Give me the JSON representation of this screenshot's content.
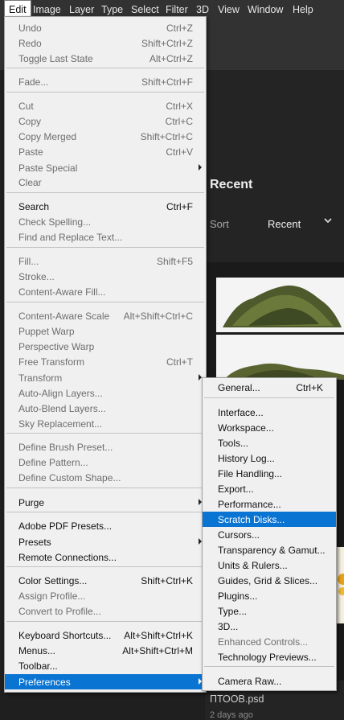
{
  "menubar": {
    "items": [
      "Edit",
      "Image",
      "Layer",
      "Type",
      "Select",
      "Filter",
      "3D",
      "View",
      "Window",
      "Help"
    ],
    "active": "Edit"
  },
  "home": {
    "section_title": "Recent",
    "sort_label": "Sort",
    "sort_value": "Recent",
    "file_name": "ПТООВ.psd",
    "file_date": "2 days ago"
  },
  "edit_menu": {
    "items": [
      {
        "label": "Undo",
        "shortcut": "Ctrl+Z",
        "enabled": false
      },
      {
        "label": "Redo",
        "shortcut": "Shift+Ctrl+Z",
        "enabled": false
      },
      {
        "label": "Toggle Last State",
        "shortcut": "Alt+Ctrl+Z",
        "enabled": false
      },
      {
        "label": "Fade...",
        "shortcut": "Shift+Ctrl+F",
        "enabled": false
      },
      {
        "label": "Cut",
        "shortcut": "Ctrl+X",
        "enabled": false
      },
      {
        "label": "Copy",
        "shortcut": "Ctrl+C",
        "enabled": false
      },
      {
        "label": "Copy Merged",
        "shortcut": "Shift+Ctrl+C",
        "enabled": false
      },
      {
        "label": "Paste",
        "shortcut": "Ctrl+V",
        "enabled": false
      },
      {
        "label": "Paste Special",
        "shortcut": "",
        "enabled": false,
        "submenu": true
      },
      {
        "label": "Clear",
        "shortcut": "",
        "enabled": false
      },
      {
        "label": "Search",
        "shortcut": "Ctrl+F",
        "enabled": true
      },
      {
        "label": "Check Spelling...",
        "shortcut": "",
        "enabled": false
      },
      {
        "label": "Find and Replace Text...",
        "shortcut": "",
        "enabled": false
      },
      {
        "label": "Fill...",
        "shortcut": "Shift+F5",
        "enabled": false
      },
      {
        "label": "Stroke...",
        "shortcut": "",
        "enabled": false
      },
      {
        "label": "Content-Aware Fill...",
        "shortcut": "",
        "enabled": false
      },
      {
        "label": "Content-Aware Scale",
        "shortcut": "Alt+Shift+Ctrl+C",
        "enabled": false
      },
      {
        "label": "Puppet Warp",
        "shortcut": "",
        "enabled": false
      },
      {
        "label": "Perspective Warp",
        "shortcut": "",
        "enabled": false
      },
      {
        "label": "Free Transform",
        "shortcut": "Ctrl+T",
        "enabled": false
      },
      {
        "label": "Transform",
        "shortcut": "",
        "enabled": false,
        "submenu": true
      },
      {
        "label": "Auto-Align Layers...",
        "shortcut": "",
        "enabled": false
      },
      {
        "label": "Auto-Blend Layers...",
        "shortcut": "",
        "enabled": false
      },
      {
        "label": "Sky Replacement...",
        "shortcut": "",
        "enabled": false
      },
      {
        "label": "Define Brush Preset...",
        "shortcut": "",
        "enabled": false
      },
      {
        "label": "Define Pattern...",
        "shortcut": "",
        "enabled": false
      },
      {
        "label": "Define Custom Shape...",
        "shortcut": "",
        "enabled": false
      },
      {
        "label": "Purge",
        "shortcut": "",
        "enabled": true,
        "submenu": true
      },
      {
        "label": "Adobe PDF Presets...",
        "shortcut": "",
        "enabled": true
      },
      {
        "label": "Presets",
        "shortcut": "",
        "enabled": true,
        "submenu": true
      },
      {
        "label": "Remote Connections...",
        "shortcut": "",
        "enabled": true
      },
      {
        "label": "Color Settings...",
        "shortcut": "Shift+Ctrl+K",
        "enabled": true
      },
      {
        "label": "Assign Profile...",
        "shortcut": "",
        "enabled": false
      },
      {
        "label": "Convert to Profile...",
        "shortcut": "",
        "enabled": false
      },
      {
        "label": "Keyboard Shortcuts...",
        "shortcut": "Alt+Shift+Ctrl+K",
        "enabled": true
      },
      {
        "label": "Menus...",
        "shortcut": "Alt+Shift+Ctrl+M",
        "enabled": true
      },
      {
        "label": "Toolbar...",
        "shortcut": "",
        "enabled": true
      },
      {
        "label": "Preferences",
        "shortcut": "",
        "enabled": true,
        "submenu": true,
        "highlighted": true
      }
    ]
  },
  "pref_menu": {
    "items": [
      {
        "label": "General...",
        "shortcut": "Ctrl+K",
        "enabled": true
      },
      {
        "label": "Interface...",
        "shortcut": "",
        "enabled": true
      },
      {
        "label": "Workspace...",
        "shortcut": "",
        "enabled": true
      },
      {
        "label": "Tools...",
        "shortcut": "",
        "enabled": true
      },
      {
        "label": "History Log...",
        "shortcut": "",
        "enabled": true
      },
      {
        "label": "File Handling...",
        "shortcut": "",
        "enabled": true
      },
      {
        "label": "Export...",
        "shortcut": "",
        "enabled": true
      },
      {
        "label": "Performance...",
        "shortcut": "",
        "enabled": true
      },
      {
        "label": "Scratch Disks...",
        "shortcut": "",
        "enabled": true,
        "highlighted": true
      },
      {
        "label": "Cursors...",
        "shortcut": "",
        "enabled": true
      },
      {
        "label": "Transparency & Gamut...",
        "shortcut": "",
        "enabled": true
      },
      {
        "label": "Units & Rulers...",
        "shortcut": "",
        "enabled": true
      },
      {
        "label": "Guides, Grid & Slices...",
        "shortcut": "",
        "enabled": true
      },
      {
        "label": "Plugins...",
        "shortcut": "",
        "enabled": true
      },
      {
        "label": "Type...",
        "shortcut": "",
        "enabled": true
      },
      {
        "label": "3D...",
        "shortcut": "",
        "enabled": true
      },
      {
        "label": "Enhanced Controls...",
        "shortcut": "",
        "enabled": false
      },
      {
        "label": "Technology Previews...",
        "shortcut": "",
        "enabled": true
      },
      {
        "label": "Camera Raw...",
        "shortcut": "",
        "enabled": true
      }
    ]
  }
}
